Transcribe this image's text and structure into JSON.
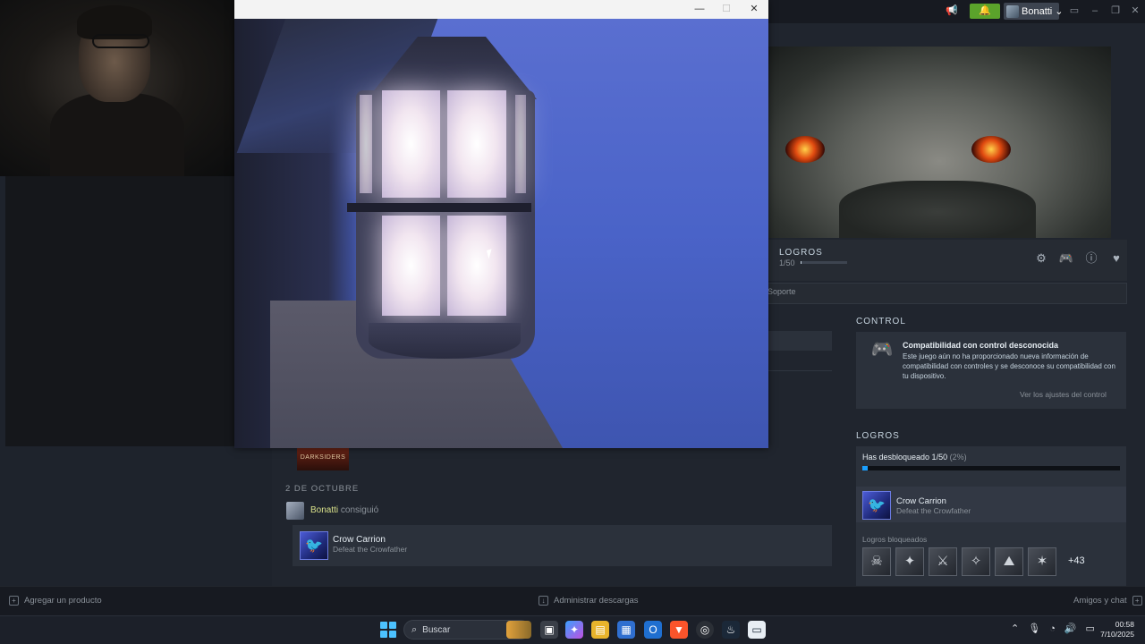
{
  "steam_header": {
    "username": "Bonatti",
    "user_caret": "⌄"
  },
  "game_bar": {
    "achievements_label": "LOGROS",
    "achievements_count": "1/50",
    "progress_fraction": 0.02,
    "support_link": "Soporte"
  },
  "control_section": {
    "heading": "CONTROL",
    "card_title": "Compatibilidad con control desconocida",
    "card_body": "Este juego aún no ha proporcionado nueva información de compatibilidad con controles y se desconoce su compatibilidad con tu dispositivo.",
    "card_link": "Ver los ajustes del control"
  },
  "achievements_section": {
    "heading": "LOGROS",
    "unlocked_text": "Has desbloqueado 1/50",
    "unlocked_pct": "(2%)",
    "unlocked_fraction": 0.02,
    "recent": {
      "title": "Crow Carrion",
      "description": "Defeat the Crowfather"
    },
    "locked_label": "Logros bloqueados",
    "locked_more": "+43"
  },
  "feed": {
    "game_thumb_text": "DARKSIDERS",
    "date": "2 DE OCTUBRE",
    "user": "Bonatti",
    "verb": "consiguió",
    "achievement_title": "Crow Carrion",
    "achievement_description": "Defeat the Crowfather"
  },
  "steam_footer": {
    "add_product": "Agregar un producto",
    "manage_downloads": "Administrar descargas",
    "friends_chat": "Amigos y chat"
  },
  "taskbar": {
    "search_placeholder": "Buscar",
    "time": "00:58",
    "date": "7/10/2025"
  },
  "colors": {
    "steam_green": "#5ba32b",
    "accent_blue": "#1a9fff",
    "windows_blue": "#4cc2ff"
  }
}
